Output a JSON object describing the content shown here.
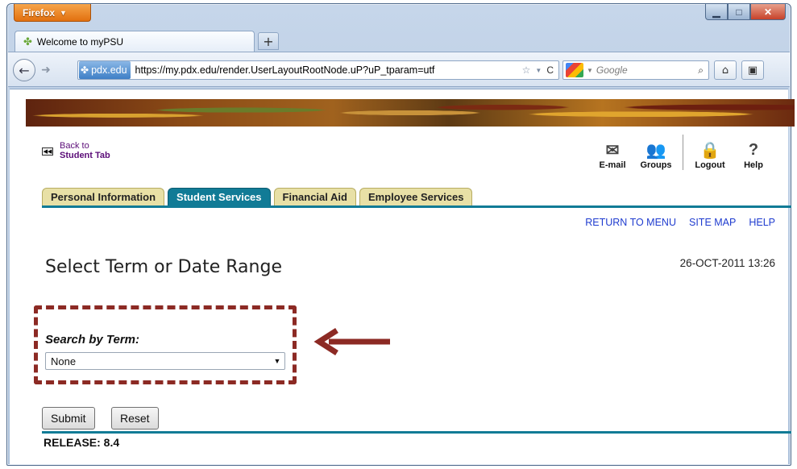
{
  "browser": {
    "menu_label": "Firefox",
    "tab_title": "Welcome to myPSU",
    "newtab_label": "+",
    "site_badge": "pdx.edu",
    "url": "https://my.pdx.edu/render.UserLayoutRootNode.uP?uP_tparam=utf",
    "search_placeholder": "Google",
    "icons": [
      "back-arrow",
      "forward-arrow",
      "star",
      "reload",
      "search",
      "home",
      "bookmark"
    ]
  },
  "portal": {
    "back_link": {
      "line1": "Back to",
      "line2": "Student Tab"
    },
    "tools": [
      {
        "label": "E-mail",
        "icon": "envelope"
      },
      {
        "label": "Groups",
        "icon": "people"
      },
      {
        "label": "Logout",
        "icon": "lock"
      },
      {
        "label": "Help",
        "icon": "question"
      }
    ],
    "tabs": [
      {
        "label": "Personal Information",
        "active": false
      },
      {
        "label": "Student Services",
        "active": true
      },
      {
        "label": "Financial Aid",
        "active": false
      },
      {
        "label": "Employee Services",
        "active": false
      }
    ],
    "links": [
      "RETURN TO MENU",
      "SITE MAP",
      "HELP"
    ]
  },
  "main": {
    "title": "Select Term or Date Range",
    "timestamp": "26-OCT-2011 13:26",
    "search_label": "Search by Term:",
    "term_value": "None",
    "submit_label": "Submit",
    "reset_label": "Reset",
    "release": "RELEASE: 8.4"
  },
  "colors": {
    "accent": "#117b96",
    "tab_inactive": "#e8e0a6",
    "highlight": "#8c2a24",
    "link": "#1f3ccf"
  }
}
